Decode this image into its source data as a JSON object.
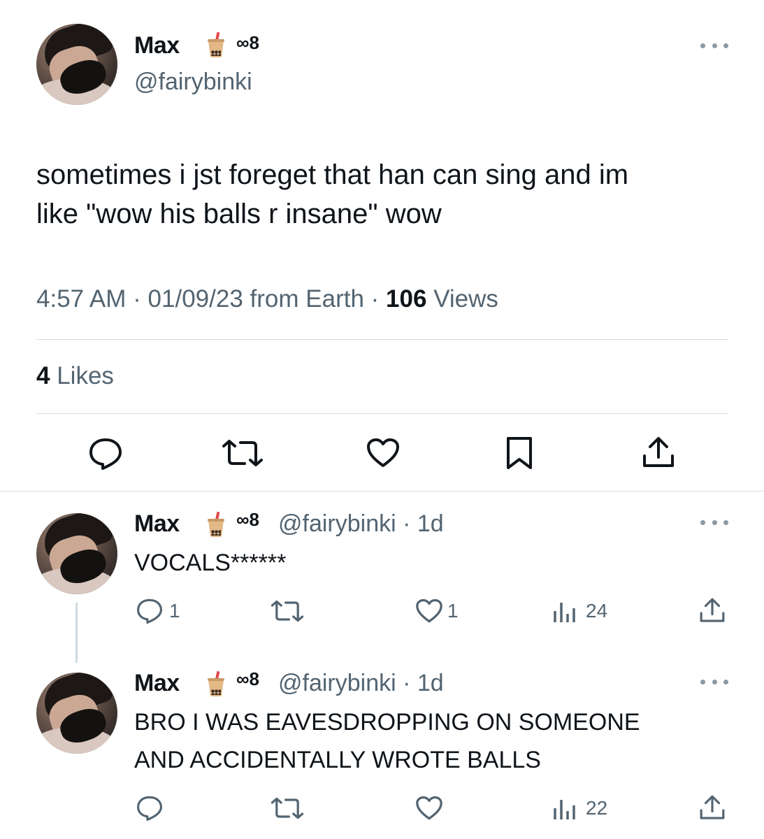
{
  "main_tweet": {
    "author_name": "Max",
    "emoji_name": "bubble-tea-icon",
    "infinity_text": "∞8",
    "handle": "@fairybinki",
    "text_line1": "sometimes i jst foreget that han can sing and im",
    "text_line2": "like \"wow his balls r insane\" wow",
    "time": "4:57 AM",
    "date": "01/09/23",
    "source": "from Earth",
    "views_count": "106",
    "views_label": "Views",
    "likes_count": "4",
    "likes_label": "Likes"
  },
  "replies": [
    {
      "author_name": "Max",
      "infinity_text": "∞8",
      "handle_time": "@fairybinki · 1d",
      "text_line1": "VOCALS******",
      "text_line2": "",
      "reply_count": "1",
      "retweet_count": "",
      "like_count": "1",
      "view_count": "24"
    },
    {
      "author_name": "Max",
      "infinity_text": "∞8",
      "handle_time": "@fairybinki · 1d",
      "text_line1": "BRO I WAS EAVESDROPPING ON SOMEONE",
      "text_line2": "AND ACCIDENTALLY WROTE BALLS",
      "reply_count": "",
      "retweet_count": "",
      "like_count": "",
      "view_count": "22"
    }
  ],
  "colors": {
    "text": "#0f1419",
    "secondary": "#536471",
    "divider": "#d9dde1"
  }
}
